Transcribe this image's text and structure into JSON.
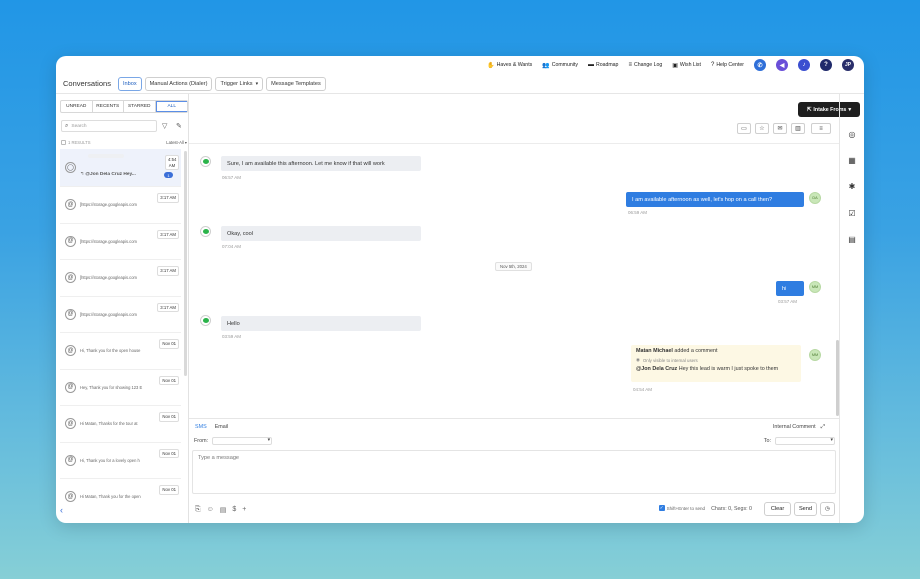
{
  "topnav": {
    "links": [
      "Haves & Wants",
      "Community",
      "Roadmap",
      "Change Log",
      "Wish List",
      "Help Center"
    ],
    "avatar_initials": "JP",
    "help_glyph": "?"
  },
  "header": {
    "title": "Conversations",
    "tabs": [
      "Inbox",
      "Manual Actions (Dialer)",
      "Trigger Links",
      "Message Templates"
    ]
  },
  "left": {
    "filters": [
      "UNREAD",
      "RECENTS",
      "STARRED",
      "ALL"
    ],
    "search_placeholder": "Search",
    "results": "1 RESULTS",
    "sort": "Latest-All",
    "conversations": [
      {
        "time": "4:54 AM",
        "preview": "@Jon Dela Cruz Hey...",
        "badge": "1"
      },
      {
        "time": "3:17 AM",
        "preview": "[https://storage.googleapis.com"
      },
      {
        "time": "3:17 AM",
        "preview": "[https://storage.googleapis.com"
      },
      {
        "time": "3:17 AM",
        "preview": "[https://storage.googleapis.com"
      },
      {
        "time": "3:17 AM",
        "preview": "[https://storage.googleapis.com"
      },
      {
        "time": "Nov 01",
        "preview": "Hi, Thank you for the open house"
      },
      {
        "time": "Nov 01",
        "preview": "Hey, Thank you for showing 123 E"
      },
      {
        "time": "Nov 01",
        "preview": "Hi Matan, Thanks for the tour at"
      },
      {
        "time": "Nov 01",
        "preview": "Hi, Thank you for a lovely open h"
      },
      {
        "time": "Nov 01",
        "preview": "Hi Matan, Thank you for the open"
      }
    ]
  },
  "main": {
    "intake_label": "Intake Froms",
    "messages": {
      "m1": "Sure, I am available this afternoon. Let me know if that will work",
      "m1_time": "06:57 AM",
      "m2": "I am available afternoon as well, let's hop on a call then?",
      "m2_time": "06:59 AM",
      "m2_initials": "DA",
      "m3": "Okay, cool",
      "m3_time": "07:04 AM",
      "date_divider": "Nov 5th, 2024",
      "m4": "hi",
      "m4_time": "03:57 AM",
      "m4_initials": "MM",
      "m5": "Hello",
      "m5_time": "03:59 AM"
    },
    "comment": {
      "author": "Matan Michael",
      "action": "added a comment",
      "visibility": "Only visible to internal users",
      "mention": "@Jon Dela Cruz",
      "text": "Hey this lead is warm I just spoke to them",
      "time": "04:54 AM",
      "initials": "MM"
    }
  },
  "composer": {
    "tab_sms": "SMS",
    "tab_email": "Email",
    "internal_comment": "Internal Comment",
    "from_label": "From:",
    "to_label": "To:",
    "message_placeholder": "Type a message",
    "shift_enter": "Shift+Enter to send",
    "chars": "Chars: 0, Segs: 0",
    "clear": "Clear",
    "send": "Send"
  },
  "colors": {
    "accent": "#2f7de1",
    "dark_button": "#1e1e1e",
    "comment_bg": "#fdf8e4"
  }
}
